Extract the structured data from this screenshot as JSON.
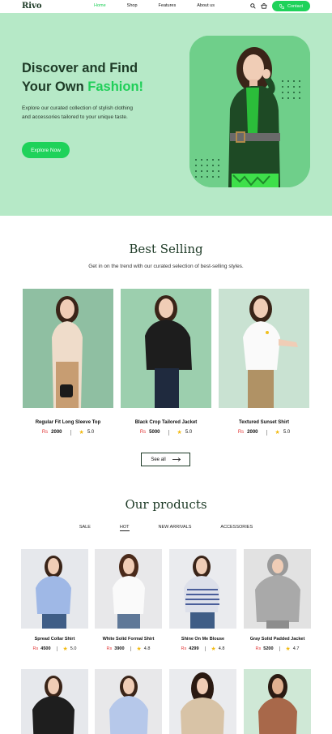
{
  "nav": {
    "logo": "Rivo",
    "links": [
      "Home",
      "Shop",
      "Features",
      "About us"
    ],
    "active_link": "Home",
    "contact_label": "Contact"
  },
  "hero": {
    "title_line1": "Discover and Find",
    "title_line2_prefix": "Your Own ",
    "title_line2_accent": "Fashion!",
    "description": "Explore our curated collection of stylish clothing and accessories tailored to your unique taste.",
    "cta_label": "Explore Now"
  },
  "best_selling": {
    "title": "Best Selling",
    "subtitle": "Get in on the trend with our curated selection of best-selling styles.",
    "currency": "Rs",
    "items": [
      {
        "name": "Regular Fit Long Sleeve Top",
        "price": "2000",
        "rating": "5.0"
      },
      {
        "name": "Black Crop Tailored Jacket",
        "price": "5000",
        "rating": "5.0"
      },
      {
        "name": "Textured Sunset Shirt",
        "price": "2000",
        "rating": "5.0"
      }
    ],
    "see_all_label": "See all"
  },
  "products": {
    "title": "Our products",
    "tabs": [
      "SALE",
      "HOT",
      "NEW ARRIVALS",
      "ACCESSORIES"
    ],
    "active_tab": "HOT",
    "currency": "Rs",
    "items": [
      {
        "name": "Spread Collar Shirt",
        "price": "4500",
        "rating": "5.0"
      },
      {
        "name": "White Solid Formal Shirt",
        "price": "3900",
        "rating": "4.8"
      },
      {
        "name": "Shine On Me Blouse",
        "price": "4299",
        "rating": "4.8"
      },
      {
        "name": "Gray Solid Padded Jacket",
        "price": "5200",
        "rating": "4.7"
      }
    ]
  },
  "colors": {
    "brand_green": "#1fd25a",
    "hero_bg": "#b6e9c7",
    "dark_green": "#1d3a26",
    "price_red": "#e23b3b",
    "star": "#f2b90f"
  },
  "icons": [
    "search-icon",
    "cart-icon",
    "phone-icon",
    "arrow-right-icon",
    "star-icon"
  ]
}
